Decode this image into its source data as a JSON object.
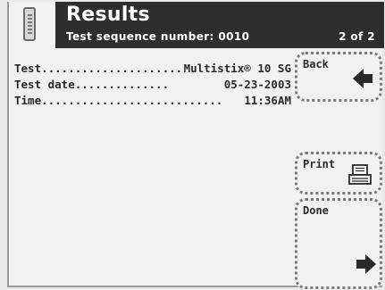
{
  "header": {
    "title": "Results",
    "subtitle": "Test sequence number: 0010",
    "page_indicator": "2 of 2",
    "device_icon": "test-strip-device-icon"
  },
  "details": [
    {
      "label": "Test",
      "dots": ".....................",
      "value": "Multistix® 10 SG"
    },
    {
      "label": "Test date",
      "dots": "..............",
      "value": "05-23-2003"
    },
    {
      "label": "Time",
      "dots": "...........................",
      "value": "11:36AM"
    }
  ],
  "buttons": {
    "back": {
      "label": "Back",
      "icon": "arrow-left-icon"
    },
    "print": {
      "label": "Print",
      "icon": "printer-icon"
    },
    "done": {
      "label": "Done",
      "icon": "arrow-right-icon"
    }
  },
  "colors": {
    "header_bg": "#2e2e2e",
    "screen_bg": "#f1f1f1",
    "text": "#2a2a2a"
  }
}
